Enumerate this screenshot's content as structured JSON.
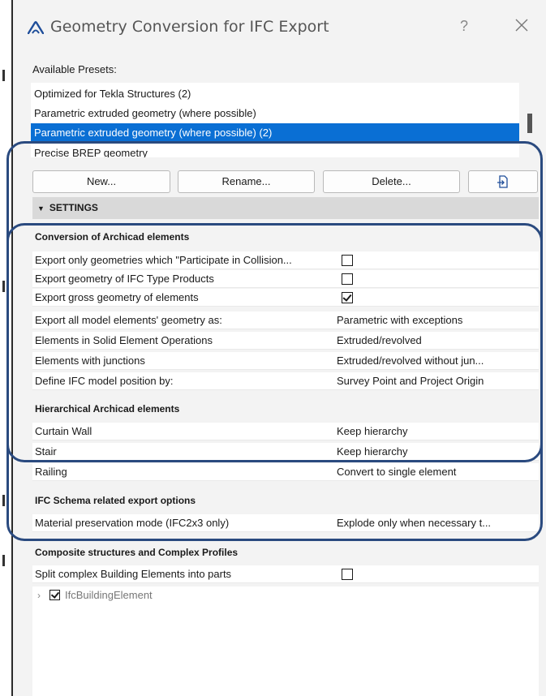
{
  "window": {
    "title": "Geometry Conversion for IFC Export",
    "help_label": "?",
    "close_icon": "close-icon",
    "logo_icon": "archicad-logo-icon"
  },
  "presets": {
    "label": "Available Presets:",
    "items": [
      "Optimized for Tekla Structures (2)",
      "Parametric extruded geometry (where possible)",
      "Parametric extruded geometry (where possible) (2)",
      "Precise BREP geometry"
    ],
    "selected": "Parametric extruded geometry (where possible) (2)"
  },
  "buttons": {
    "new": "New...",
    "rename": "Rename...",
    "delete": "Delete...",
    "export_icon": "export-icon"
  },
  "settings": {
    "header": "SETTINGS",
    "sections": {
      "conversion": {
        "title": "Conversion of Archicad elements",
        "rows": [
          {
            "label": "Export only geometries which \"Participate in Collision...",
            "checked": false
          },
          {
            "label": "Export geometry of IFC Type Products",
            "checked": false
          },
          {
            "label": "Export gross geometry of elements",
            "checked": true
          },
          {
            "label": "Export all model elements' geometry as:",
            "value": "Parametric with exceptions"
          },
          {
            "label": "Elements in Solid Element Operations",
            "value": "Extruded/revolved"
          },
          {
            "label": "Elements with junctions",
            "value": "Extruded/revolved without jun..."
          },
          {
            "label": "Define IFC model position by:",
            "value": "Survey Point and Project Origin"
          }
        ]
      },
      "hierarchical": {
        "title": "Hierarchical Archicad elements",
        "rows": [
          {
            "label": "Curtain Wall",
            "value": "Keep hierarchy"
          },
          {
            "label": "Stair",
            "value": "Keep hierarchy"
          },
          {
            "label": "Railing",
            "value": "Convert to single element"
          }
        ]
      },
      "schema": {
        "title": "IFC Schema related export options",
        "rows": [
          {
            "label": "Material preservation mode (IFC2x3 only)",
            "value": "Explode only when necessary t..."
          }
        ]
      },
      "composite": {
        "title": "Composite structures and Complex Profiles",
        "rows": [
          {
            "label": "Split complex Building Elements into parts",
            "checked": false
          }
        ],
        "tree": {
          "label": "IfcBuildingElement",
          "checked": true
        }
      }
    }
  },
  "colors": {
    "selection": "#0a6fd4",
    "highlight_outline": "#2a4a7f",
    "settings_bar": "#d9d9d9"
  }
}
